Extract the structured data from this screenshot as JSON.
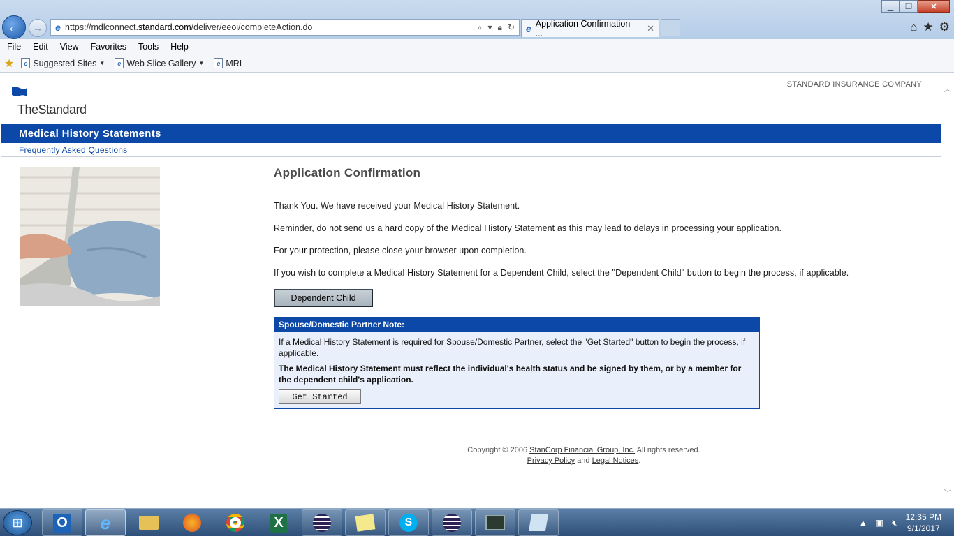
{
  "browser": {
    "url_prefix": "https://mdlconnect.",
    "url_domain": "standard.com",
    "url_suffix": "/deliver/eeoi/completeAction.do",
    "tab_title": "Application Confirmation - ...",
    "menu": [
      "File",
      "Edit",
      "View",
      "Favorites",
      "Tools",
      "Help"
    ],
    "favorites": [
      "Suggested Sites",
      "Web Slice Gallery",
      "MRI"
    ]
  },
  "page": {
    "logo": "TheStandard",
    "company": "STANDARD INSURANCE COMPANY",
    "banner_title": "Medical History Statements",
    "faq_link": "Frequently Asked Questions",
    "title": "Application Confirmation",
    "paragraphs": [
      "Thank You. We have received your Medical History Statement.",
      "Reminder, do not send us a hard copy of the Medical History Statement as this may lead to delays in processing your application.",
      "For your protection, please close your browser upon completion.",
      "If you wish to complete a Medical History Statement for a Dependent Child, select the \"Dependent Child\" button to begin the process, if applicable."
    ],
    "dependent_button": "Dependent Child",
    "note": {
      "heading": "Spouse/Domestic Partner Note:",
      "text": "If a Medical History Statement is required for Spouse/Domestic Partner, select the \"Get Started\" button to begin the process, if applicable.",
      "bold_text": "The Medical History Statement must reflect the individual's health status and be signed by them, or by a member for the dependent child's application.",
      "button": "Get Started"
    },
    "footer": {
      "copyright_prefix": "Copyright © 2006",
      "company_link": "StanCorp Financial Group, Inc.",
      "copyright_suffix": "All rights reserved.",
      "privacy_link": "Privacy Policy",
      "and": "and",
      "legal_link": "Legal Notices",
      "period": "."
    }
  },
  "taskbar": {
    "time": "12:35 PM",
    "date": "9/1/2017"
  },
  "colors": {
    "brand_blue": "#0b48a8"
  }
}
